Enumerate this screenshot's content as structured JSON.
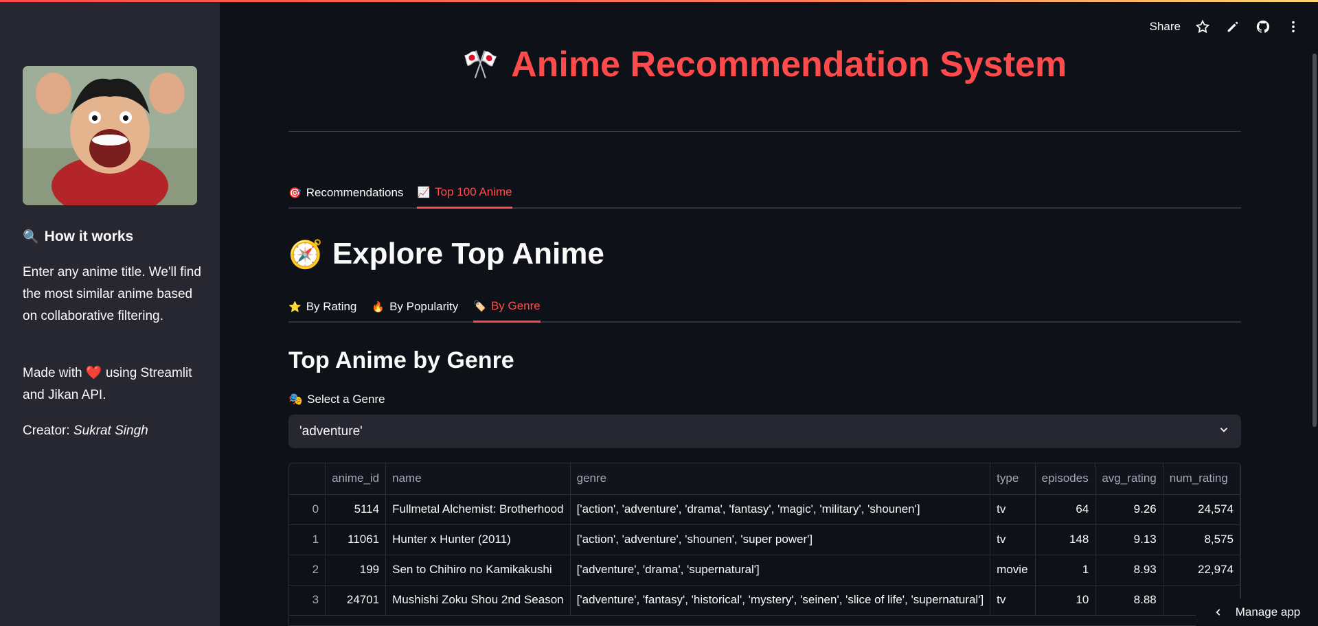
{
  "header": {
    "share_label": "Share",
    "icons": [
      "star-icon",
      "pencil-icon",
      "github-icon",
      "more-vert-icon"
    ]
  },
  "sidebar": {
    "image_alt": "anime character cheering",
    "how_title": "How it works",
    "how_icon": "🔍",
    "p1": "Enter any anime title. We'll find the most similar anime based on collaborative filtering.",
    "p2_pre": "Made with",
    "p2_heart": "❤️",
    "p2_post": "using Streamlit and Jikan API.",
    "creator_label": "Creator:",
    "creator_name": "Sukrat Singh"
  },
  "main": {
    "title_icon": "🎌",
    "title": "Anime Recommendation System",
    "tabs": [
      {
        "icon": "🎯",
        "label": "Recommendations",
        "active": false
      },
      {
        "icon": "📈",
        "label": "Top 100 Anime",
        "active": true
      }
    ],
    "explore_icon": "🧭",
    "explore_title": "Explore Top Anime",
    "subtabs": [
      {
        "icon": "⭐",
        "label": "By Rating",
        "active": false
      },
      {
        "icon": "🔥",
        "label": "By Popularity",
        "active": false
      },
      {
        "icon": "🏷️",
        "label": "By Genre",
        "active": true
      }
    ],
    "genre_title": "Top Anime by Genre",
    "select_icon": "🎭",
    "select_label": "Select a Genre",
    "select_value": "'adventure'"
  },
  "table": {
    "columns": [
      "",
      "anime_id",
      "name",
      "genre",
      "type",
      "episodes",
      "avg_rating",
      "num_rating"
    ],
    "rows": [
      [
        "0",
        "5114",
        "Fullmetal Alchemist: Brotherhood",
        "['action', 'adventure', 'drama', 'fantasy', 'magic', 'military', 'shounen']",
        "tv",
        "64",
        "9.26",
        "24,574"
      ],
      [
        "1",
        "11061",
        "Hunter x Hunter (2011)",
        "['action', 'adventure', 'shounen', 'super power']",
        "tv",
        "148",
        "9.13",
        "8,575"
      ],
      [
        "2",
        "199",
        "Sen to Chihiro no Kamikakushi",
        "['adventure', 'drama', 'supernatural']",
        "movie",
        "1",
        "8.93",
        "22,974"
      ],
      [
        "3",
        "24701",
        "Mushishi Zoku Shou 2nd Season",
        "['adventure', 'fantasy', 'historical', 'mystery', 'seinen', 'slice of life', 'supernatural']",
        "tv",
        "10",
        "8.88",
        ""
      ]
    ]
  },
  "footer": {
    "manage_label": "Manage app"
  }
}
